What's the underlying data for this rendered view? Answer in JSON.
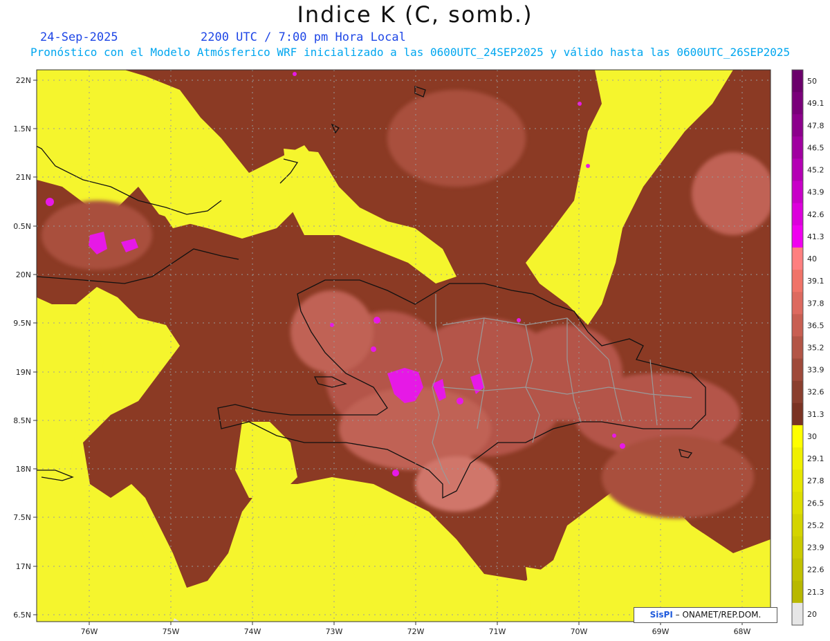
{
  "header": {
    "title": "Indice K (C, somb.)",
    "date": "24-Sep-2025",
    "time": "2200 UTC / 7:00 pm Hora Local",
    "subtitle": "Pronóstico con el Modelo Atmósferico WRF inicializado a las 0600UTC_24SEP2025 y válido hasta las  0600UTC_26SEP2025"
  },
  "map": {
    "lat_labels": [
      "22N",
      "1.5N",
      "21N",
      "0.5N",
      "20N",
      "9.5N",
      "19N",
      "8.5N",
      "18N",
      "7.5N",
      "17N",
      "6.5N"
    ],
    "lon_labels": [
      "76W",
      "75W",
      "74W",
      "73W",
      "72W",
      "71W",
      "70W",
      "69W",
      "68W"
    ],
    "colors": {
      "yellow": "#f5f52d",
      "brown_dark": "#8b3a24",
      "brown_mid": "#a9503e",
      "salmon": "#cc6b60",
      "salmon_light": "#e0857b",
      "magenta": "#e619e6",
      "land_grey": "#e6e6e6",
      "coast": "#111111",
      "provinces": "#9a9a9a"
    }
  },
  "colorbar": {
    "labels": [
      "50",
      "49.1",
      "47.8",
      "46.5",
      "45.2",
      "43.9",
      "42.6",
      "41.3",
      "40",
      "39.1",
      "37.8",
      "36.5",
      "35.2",
      "33.9",
      "32.6",
      "31.3",
      "30",
      "29.1",
      "27.8",
      "26.5",
      "25.2",
      "23.9",
      "22.6",
      "21.3",
      "20"
    ],
    "colors": [
      "#6b006b",
      "#7a007a",
      "#8c008c",
      "#a000a0",
      "#b400b4",
      "#c800c8",
      "#dc00dc",
      "#f000f0",
      "#ff7f7f",
      "#f07368",
      "#dd6a5f",
      "#c85f52",
      "#b35546",
      "#9f4a3a",
      "#8a3f2e",
      "#7a3323",
      "#ffff00",
      "#f0f000",
      "#e6e600",
      "#dede00",
      "#d4d400",
      "#cbcb00",
      "#c2c200",
      "#b8b800",
      "#e6e6e6"
    ]
  },
  "credit": {
    "brand": "SisPI",
    "text": "– ONAMET/REP.DOM."
  }
}
